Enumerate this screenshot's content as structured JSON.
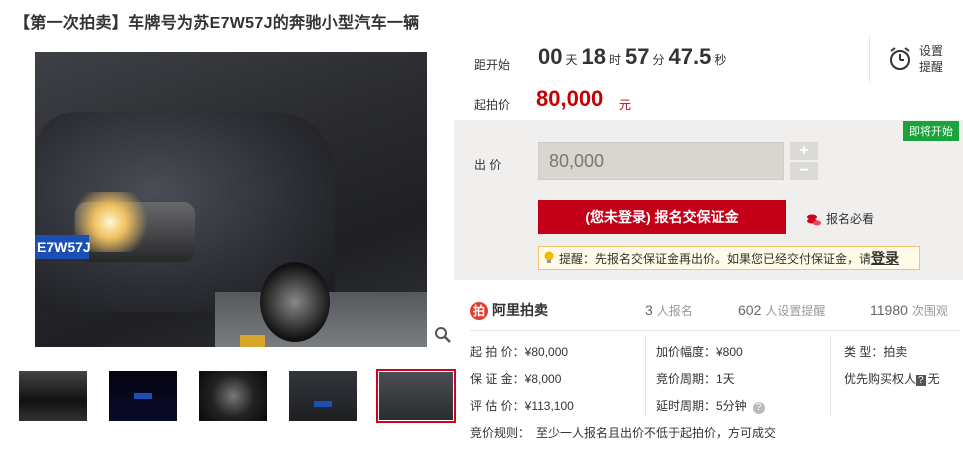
{
  "title": "【第一次拍卖】车牌号为苏E7W57J的奔驰小型汽车一辆",
  "gallery": {
    "plate_text": "E7W57J",
    "thumb_count": 5,
    "selected_thumb": 5
  },
  "countdown": {
    "label": "距开始",
    "days": "00",
    "days_unit": "天",
    "hours": "18",
    "hours_unit": "时",
    "minutes": "57",
    "minutes_unit": "分",
    "seconds": "47.5",
    "seconds_unit": "秒"
  },
  "start_price": {
    "label": "起拍价",
    "value": "80,000",
    "unit": "元"
  },
  "remind": {
    "line1": "设置",
    "line2": "提醒"
  },
  "bid": {
    "badge": "即将开始",
    "label": "出  价",
    "value": "80,000",
    "plus": "+",
    "minus": "−",
    "signup_button": "(您未登录) 报名交保证金",
    "must_read": "报名必看",
    "tip_text": "提醒：先报名交保证金再出价。如果您已经交付保证金，请",
    "tip_link": "登录"
  },
  "stats": {
    "logo_text": "阿里拍卖",
    "signups": "3",
    "signups_label": "人报名",
    "reminders": "602",
    "reminders_label": "人设置提醒",
    "views": "11980",
    "views_label": "次围观"
  },
  "details": {
    "start_price": "起 拍 价：¥80,000",
    "deposit": "保 证 金：¥8,000",
    "appraisal": "评 估 价：¥113,100",
    "increment": "加价幅度：¥800",
    "cycle": "竞价周期：1天",
    "delay": "延时周期：5分钟",
    "type_label": "类      型：",
    "type_value": "拍卖",
    "priority_label": "优先购买权人",
    "priority_tag": "?",
    "priority_value": "无",
    "rule_label": "竞价规则：",
    "rule_value": "至少一人报名且出价不低于起拍价，方可成交"
  },
  "colors": {
    "accent_red": "#c40018",
    "price_red": "#c40000",
    "badge_green": "#1aa33a"
  }
}
